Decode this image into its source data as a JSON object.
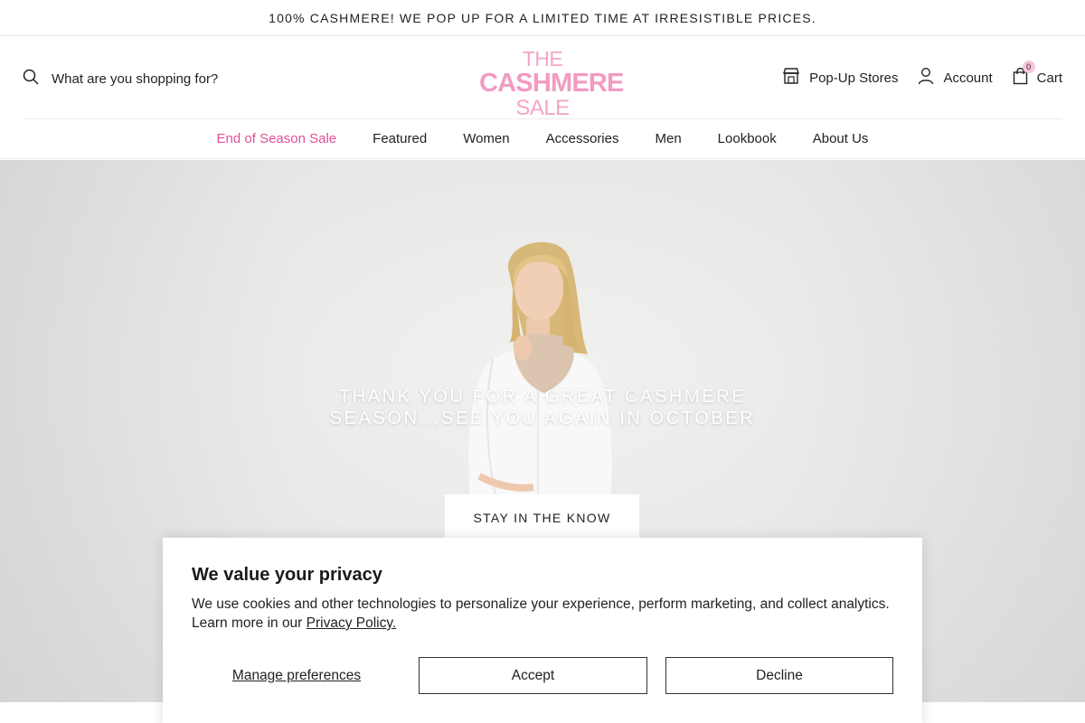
{
  "announcement": "100% CASHMERE! WE POP UP FOR A LIMITED TIME AT IRRESISTIBLE PRICES.",
  "header": {
    "search_placeholder": "What are you shopping for?",
    "logo": {
      "line1": "THE",
      "line2": "CASHMERE",
      "line3": "SALE"
    },
    "popup_stores": "Pop-Up Stores",
    "account": "Account",
    "cart": "Cart",
    "cart_count": "0"
  },
  "nav": {
    "items": [
      "End of Season Sale",
      "Featured",
      "Women",
      "Accessories",
      "Men",
      "Lookbook",
      "About Us"
    ]
  },
  "hero": {
    "title": "THANK YOU FOR A GREAT CASHMERE SEASON...SEE YOU AGAIN IN OCTOBER",
    "button": "STAY IN THE KNOW"
  },
  "cookie": {
    "title": "We value your privacy",
    "text": "We use cookies and other technologies to personalize your experience, perform marketing, and collect analytics. Learn more in our ",
    "link": "Privacy Policy.",
    "manage": "Manage preferences",
    "accept": "Accept",
    "decline": "Decline"
  },
  "colors": {
    "accent_pink": "#e0509a",
    "logo_pink": "#f29bc1"
  }
}
